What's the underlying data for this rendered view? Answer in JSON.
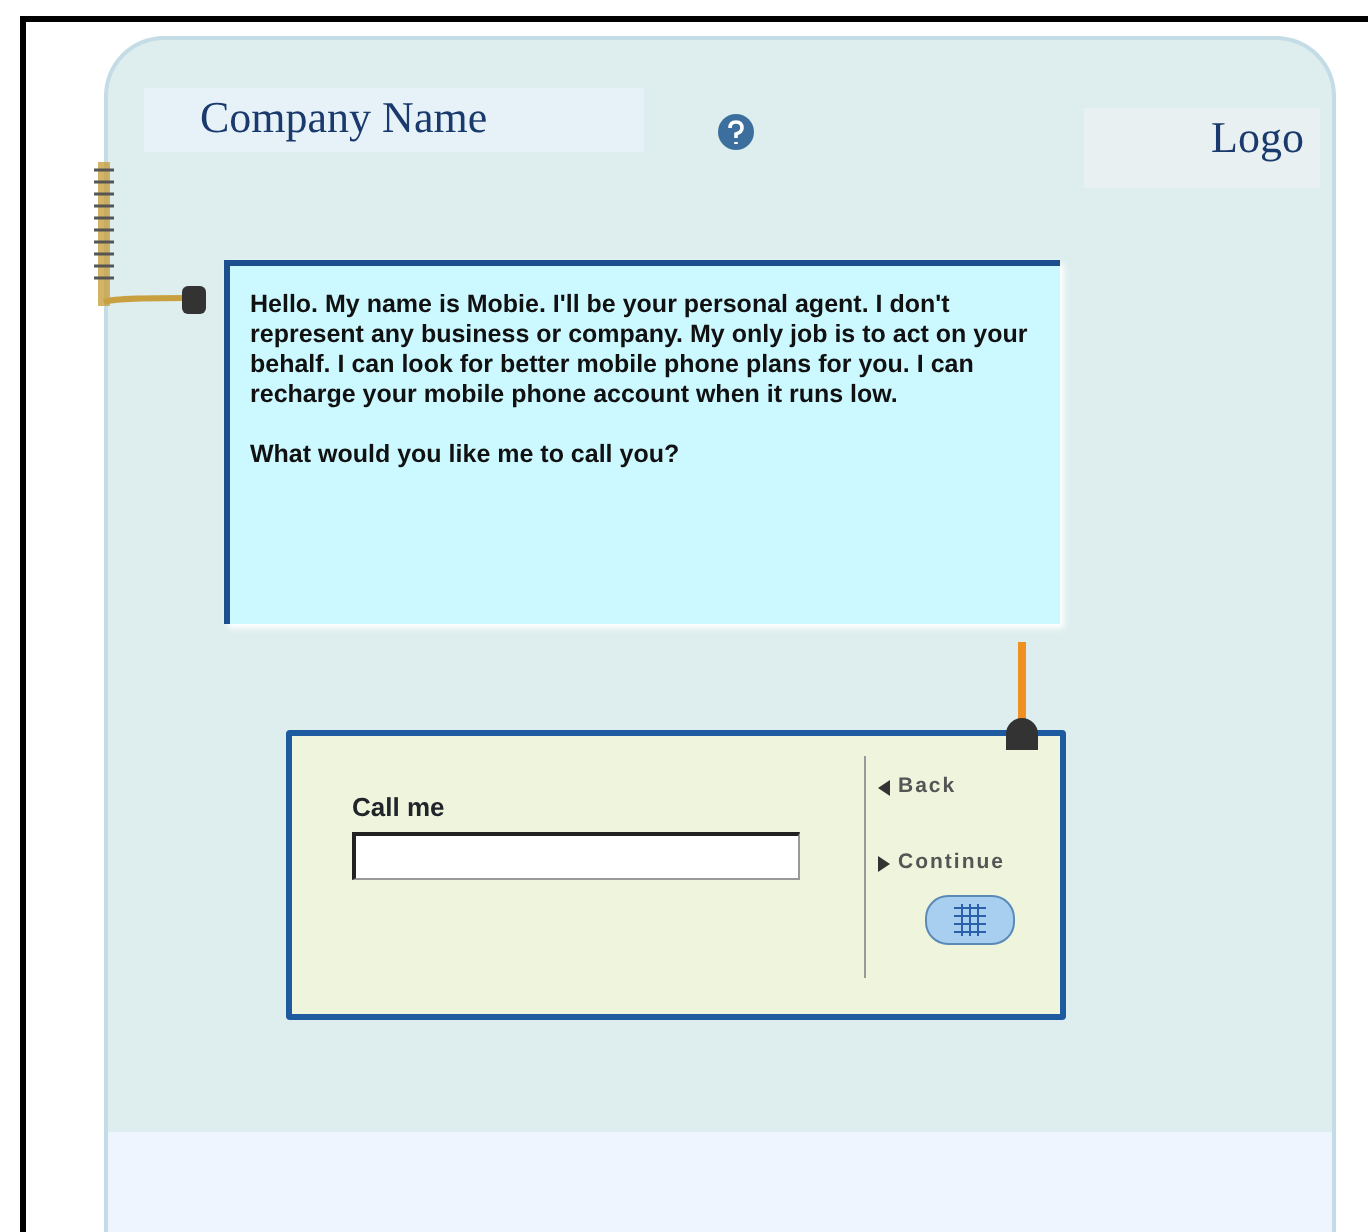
{
  "header": {
    "company_name": "Company Name",
    "logo": "Logo"
  },
  "message": {
    "paragraphs": [
      "Hello. My name is Mobie. I'll be your personal agent. I don't represent any business or company. My only job is to act on your behalf. I can look for better mobile phone plans for you. I can recharge your mobile phone account when it runs low.",
      "What would you like me to call you?"
    ]
  },
  "form": {
    "label": "Call me",
    "nav": [
      {
        "kind": "back",
        "label": "Back"
      },
      {
        "kind": "continue",
        "label": "Continue"
      }
    ]
  }
}
